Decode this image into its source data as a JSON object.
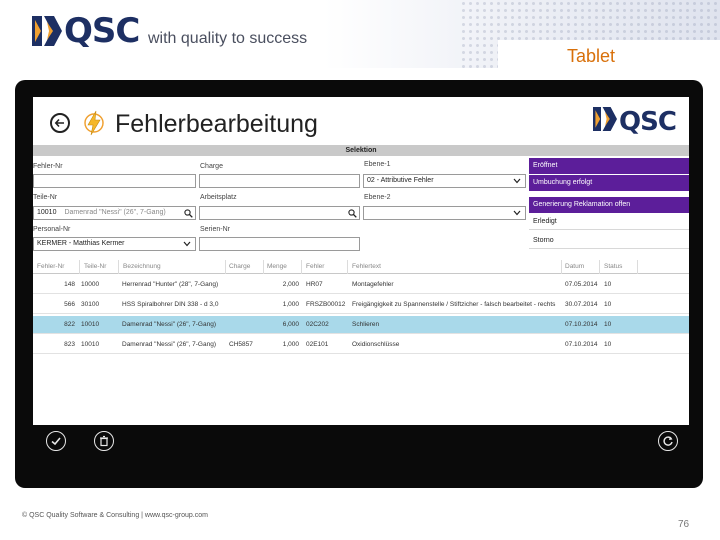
{
  "slide": {
    "logo_text": "QSC",
    "tagline": "with quality to success",
    "device_label": "Tablet",
    "footer": "© QSC Quality Software & Consulting | www.qsc-group.com",
    "page_number": "76"
  },
  "app": {
    "title": "Fehlerbearbeitung",
    "logo_text": "QSC",
    "selektion_label": "Selektion",
    "accent_color": "#5c1e9a",
    "selected_row_color": "#a9d9ea"
  },
  "form": {
    "fehler_nr": {
      "label": "Fehler-Nr",
      "value": ""
    },
    "charge": {
      "label": "Charge",
      "value": ""
    },
    "ebene1": {
      "label": "Ebene-1",
      "value": "02 - Attributive Fehler"
    },
    "teile_nr": {
      "label": "Teile-Nr",
      "value": "10010",
      "desc": "Damenrad \"Nessi\" (26\", 7-Gang)"
    },
    "arbeitsplatz": {
      "label": "Arbeitsplatz",
      "value": ""
    },
    "ebene2": {
      "label": "Ebene-2",
      "value": ""
    },
    "personal_nr": {
      "label": "Personal-Nr",
      "value": "KERMER - Matthias Kermer"
    },
    "serien_nr": {
      "label": "Serien-Nr",
      "value": ""
    }
  },
  "status_options": [
    {
      "label": "Eröffnet",
      "active": true
    },
    {
      "label": "Umbuchung erfolgt",
      "active": true
    },
    {
      "label": "Generierung Reklamation offen",
      "active": true
    },
    {
      "label": "Erledigt",
      "active": false
    },
    {
      "label": "Storno",
      "active": false
    }
  ],
  "table": {
    "columns": [
      "Fehler-Nr",
      "Teile-Nr",
      "Bezeichnung",
      "Charge",
      "Menge",
      "Fehler",
      "Fehlertext",
      "Datum",
      "Status"
    ],
    "rows": [
      {
        "fehler_nr": "148",
        "teile_nr": "10000",
        "bezeichnung": "Herrenrad \"Hunter\" (28\", 7-Gang)",
        "charge": "",
        "menge": "2,000",
        "fehler": "HR07",
        "fehlertext": "Montagefehler",
        "datum": "07.05.2014",
        "status": "10",
        "selected": false
      },
      {
        "fehler_nr": "566",
        "teile_nr": "30100",
        "bezeichnung": "HSS Spiralbohrer DIN 338 - d 3,0",
        "charge": "",
        "menge": "1,000",
        "fehler": "FRSZB00012",
        "fehlertext": "Freigängigkeit zu Spannenstelle / Stiftzicher - falsch bearbeitet - rechts",
        "datum": "30.07.2014",
        "status": "10",
        "selected": false
      },
      {
        "fehler_nr": "822",
        "teile_nr": "10010",
        "bezeichnung": "Damenrad \"Nessi\" (26\", 7-Gang)",
        "charge": "",
        "menge": "6,000",
        "fehler": "02C202",
        "fehlertext": "Schlieren",
        "datum": "07.10.2014",
        "status": "10",
        "selected": true
      },
      {
        "fehler_nr": "823",
        "teile_nr": "10010",
        "bezeichnung": "Damenrad \"Nessi\" (26\", 7-Gang)",
        "charge": "CH5857",
        "menge": "1,000",
        "fehler": "02E101",
        "fehlertext": "Oxidionschlüsse",
        "datum": "07.10.2014",
        "status": "10",
        "selected": false
      }
    ]
  },
  "icons": {
    "back": "back-arrow-icon",
    "bolt": "lightning-bolt-icon",
    "check": "check-icon",
    "delete": "delete-icon",
    "refresh": "refresh-icon",
    "search": "search-icon",
    "dropdown": "chevron-down-icon"
  }
}
